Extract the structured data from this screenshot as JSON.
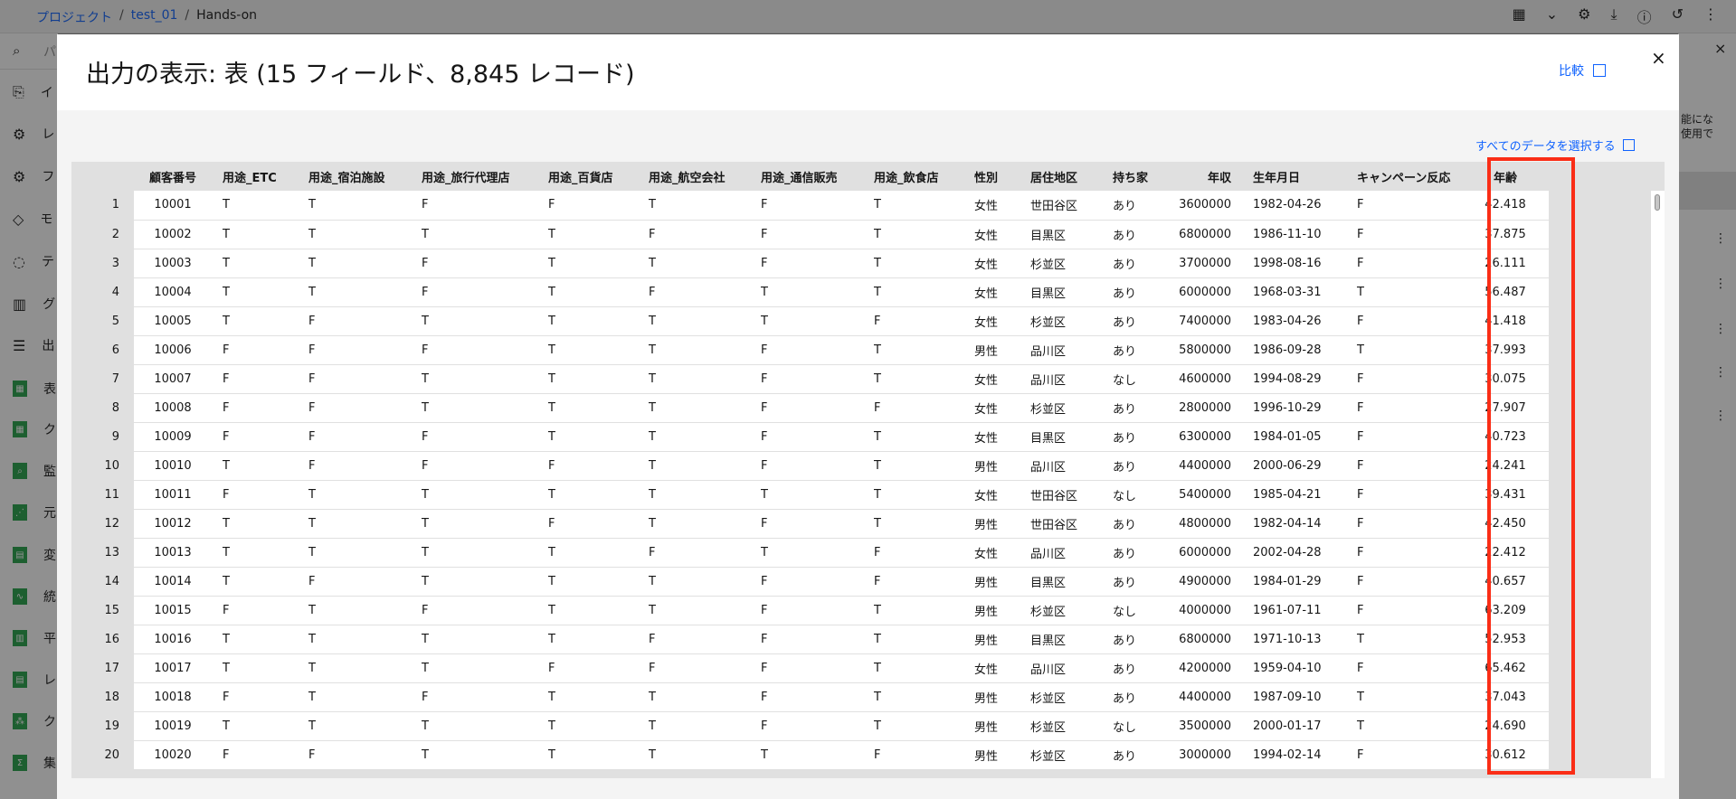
{
  "breadcrumb": {
    "project": "プロジェクト",
    "sep": "/",
    "flow": "test_01",
    "current": "Hands-on"
  },
  "search": {
    "placeholder": "パ"
  },
  "sidebar": {
    "items": [
      {
        "icon": "document-import-icon",
        "label": "イ"
      },
      {
        "icon": "recipe-icon",
        "label": "レ"
      },
      {
        "icon": "field-ops-icon",
        "label": "フ"
      },
      {
        "icon": "model-gem-icon",
        "label": "モ"
      },
      {
        "icon": "text-bubble-icon",
        "label": "テ"
      },
      {
        "icon": "chart-icon",
        "label": "グ"
      },
      {
        "icon": "output-icon",
        "label": "出"
      }
    ],
    "nodes": [
      "表",
      "ク",
      "監",
      "元",
      "変",
      "統",
      "平",
      "レ",
      "ク",
      "集"
    ]
  },
  "rightpanel": {
    "text_line1": "能にな",
    "text_line2": "使用で"
  },
  "modal": {
    "title": "出力の表示: 表 (15 フィールド、8,845 レコード)",
    "compare_label": "比較",
    "close_label": "×",
    "select_all_label": "すべてのデータを選択する"
  },
  "table": {
    "columns": [
      "",
      "顧客番号",
      "用途_ETC",
      "用途_宿泊施設",
      "用途_旅行代理店",
      "用途_百貨店",
      "用途_航空会社",
      "用途_通信販売",
      "用途_飲食店",
      "性別",
      "居住地区",
      "持ち家",
      "年収",
      "生年月日",
      "キャンペーン反応",
      "年齢"
    ],
    "rows": [
      [
        "1",
        "10001",
        "T",
        "T",
        "F",
        "F",
        "T",
        "F",
        "T",
        "女性",
        "世田谷区",
        "あり",
        "3600000",
        "1982-04-26",
        "F",
        "42.418"
      ],
      [
        "2",
        "10002",
        "T",
        "T",
        "T",
        "T",
        "F",
        "F",
        "T",
        "女性",
        "目黒区",
        "あり",
        "6800000",
        "1986-11-10",
        "F",
        "37.875"
      ],
      [
        "3",
        "10003",
        "T",
        "T",
        "F",
        "T",
        "T",
        "F",
        "T",
        "女性",
        "杉並区",
        "あり",
        "3700000",
        "1998-08-16",
        "F",
        "26.111"
      ],
      [
        "4",
        "10004",
        "T",
        "T",
        "F",
        "T",
        "F",
        "T",
        "T",
        "女性",
        "目黒区",
        "あり",
        "6000000",
        "1968-03-31",
        "T",
        "56.487"
      ],
      [
        "5",
        "10005",
        "T",
        "F",
        "T",
        "T",
        "T",
        "T",
        "F",
        "女性",
        "杉並区",
        "あり",
        "7400000",
        "1983-04-26",
        "F",
        "41.418"
      ],
      [
        "6",
        "10006",
        "F",
        "F",
        "F",
        "T",
        "T",
        "F",
        "T",
        "男性",
        "品川区",
        "あり",
        "5800000",
        "1986-09-28",
        "T",
        "37.993"
      ],
      [
        "7",
        "10007",
        "F",
        "F",
        "T",
        "T",
        "T",
        "F",
        "T",
        "女性",
        "品川区",
        "なし",
        "4600000",
        "1994-08-29",
        "F",
        "30.075"
      ],
      [
        "8",
        "10008",
        "F",
        "F",
        "T",
        "T",
        "T",
        "F",
        "F",
        "女性",
        "杉並区",
        "あり",
        "2800000",
        "1996-10-29",
        "F",
        "27.907"
      ],
      [
        "9",
        "10009",
        "F",
        "F",
        "F",
        "T",
        "T",
        "F",
        "T",
        "女性",
        "目黒区",
        "あり",
        "6300000",
        "1984-01-05",
        "F",
        "40.723"
      ],
      [
        "10",
        "10010",
        "T",
        "F",
        "F",
        "F",
        "T",
        "F",
        "T",
        "男性",
        "品川区",
        "あり",
        "4400000",
        "2000-06-29",
        "F",
        "24.241"
      ],
      [
        "11",
        "10011",
        "F",
        "T",
        "T",
        "T",
        "T",
        "T",
        "T",
        "女性",
        "世田谷区",
        "なし",
        "5400000",
        "1985-04-21",
        "F",
        "39.431"
      ],
      [
        "12",
        "10012",
        "T",
        "T",
        "T",
        "F",
        "T",
        "F",
        "T",
        "男性",
        "世田谷区",
        "あり",
        "4800000",
        "1982-04-14",
        "F",
        "42.450"
      ],
      [
        "13",
        "10013",
        "T",
        "T",
        "T",
        "T",
        "F",
        "T",
        "F",
        "女性",
        "品川区",
        "あり",
        "6000000",
        "2002-04-28",
        "F",
        "22.412"
      ],
      [
        "14",
        "10014",
        "T",
        "F",
        "T",
        "T",
        "T",
        "F",
        "F",
        "男性",
        "目黒区",
        "あり",
        "4900000",
        "1984-01-29",
        "F",
        "40.657"
      ],
      [
        "15",
        "10015",
        "F",
        "T",
        "F",
        "T",
        "T",
        "F",
        "T",
        "男性",
        "杉並区",
        "なし",
        "4000000",
        "1961-07-11",
        "F",
        "63.209"
      ],
      [
        "16",
        "10016",
        "T",
        "T",
        "T",
        "T",
        "F",
        "F",
        "T",
        "男性",
        "目黒区",
        "あり",
        "6800000",
        "1971-10-13",
        "T",
        "52.953"
      ],
      [
        "17",
        "10017",
        "T",
        "T",
        "T",
        "F",
        "F",
        "F",
        "T",
        "女性",
        "品川区",
        "あり",
        "4200000",
        "1959-04-10",
        "F",
        "65.462"
      ],
      [
        "18",
        "10018",
        "F",
        "T",
        "F",
        "T",
        "T",
        "F",
        "T",
        "男性",
        "杉並区",
        "あり",
        "4400000",
        "1987-09-10",
        "T",
        "37.043"
      ],
      [
        "19",
        "10019",
        "T",
        "T",
        "T",
        "T",
        "T",
        "F",
        "T",
        "男性",
        "杉並区",
        "なし",
        "3500000",
        "2000-01-17",
        "T",
        "24.690"
      ],
      [
        "20",
        "10020",
        "F",
        "F",
        "T",
        "T",
        "T",
        "T",
        "F",
        "男性",
        "杉並区",
        "あり",
        "3000000",
        "1994-02-14",
        "F",
        "30.612"
      ]
    ]
  },
  "colors": {
    "accent": "#0f62fe",
    "highlight": "#fa2d16",
    "node": "#24a148"
  }
}
